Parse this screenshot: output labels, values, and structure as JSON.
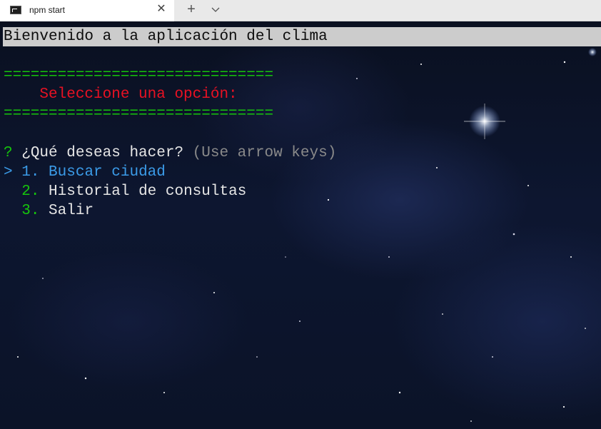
{
  "tab": {
    "title": "npm start",
    "close_symbol": "✕",
    "new_tab_symbol": "+"
  },
  "terminal": {
    "banner": "Bienvenido a la aplicación del clima",
    "separator": "==============================",
    "select_prompt": "    Seleccione una opción:",
    "question_mark": "?",
    "question": "¿Qué deseas hacer?",
    "hint": "(Use arrow keys)",
    "pointer": ">",
    "options": [
      {
        "number": "1.",
        "label": "Buscar ciudad",
        "selected": true
      },
      {
        "number": "2.",
        "label": "Historial de consultas",
        "selected": false
      },
      {
        "number": "3.",
        "label": "Salir",
        "selected": false
      }
    ]
  },
  "colors": {
    "green": "#16c60c",
    "red": "#e81123",
    "blue": "#3b9be8",
    "gray": "#8a8a8a",
    "banner_bg": "#cccccc"
  }
}
